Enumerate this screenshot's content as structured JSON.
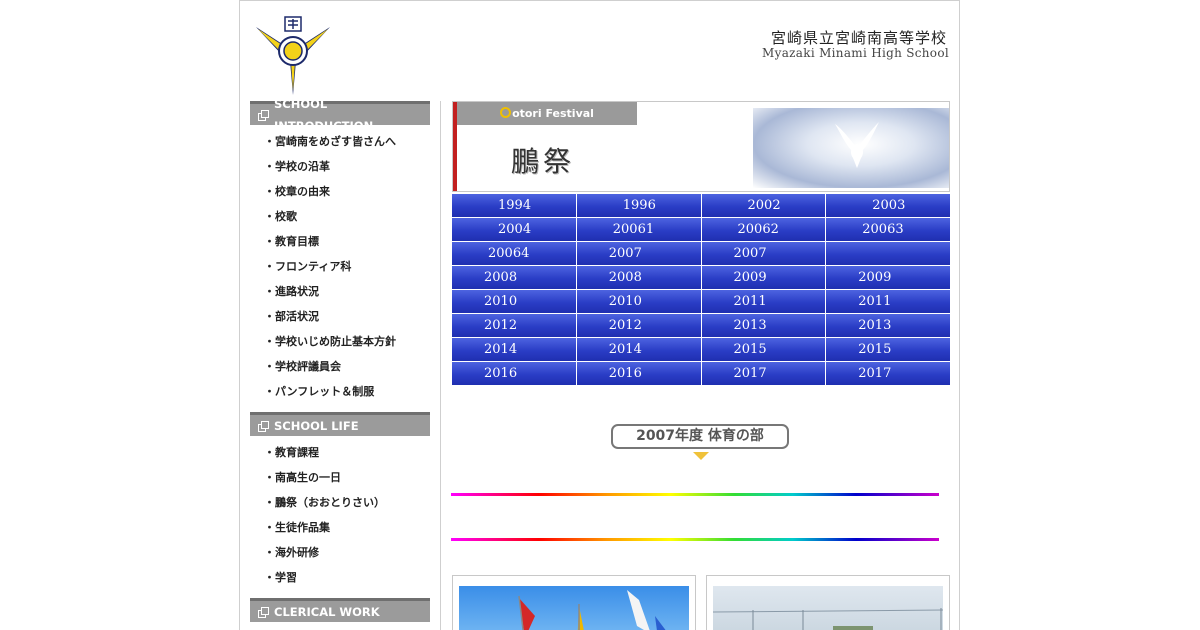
{
  "header": {
    "school_name_jp": "宮崎県立宮崎南高等学校",
    "school_name_en": "Myazaki Minami High School"
  },
  "sidebar": {
    "sections": [
      {
        "title": "SCHOOL INTRODUCTION",
        "items": [
          "宮崎南をめざす皆さんへ",
          "学校の沿革",
          "校章の由来",
          "校歌",
          "教育目標",
          "フロンティア科",
          "進路状況",
          "部活状況",
          "学校いじめ防止基本方針",
          "学校評議員会",
          "パンフレット＆制服"
        ]
      },
      {
        "title": "SCHOOL LIFE",
        "items": [
          "教育課程",
          "南高生の一日",
          "鵬祭（おおとりさい）",
          "生徒作品集",
          "海外研修",
          "学習"
        ]
      },
      {
        "title": "CLERICAL WORK",
        "items": []
      }
    ]
  },
  "banner": {
    "tab_label_first": "O",
    "tab_label_rest": "otori Festival",
    "title": "鵬祭"
  },
  "years": [
    [
      "1994",
      "1996",
      "2002",
      "2003"
    ],
    [
      "2004",
      "20061",
      "20062",
      "20063"
    ],
    [
      "20064",
      "2007",
      "2007",
      ""
    ],
    [
      "2008",
      "2008",
      "2009",
      "2009"
    ],
    [
      "2010",
      "2010",
      "2011",
      "2011"
    ],
    [
      "2012",
      "2012",
      "2013",
      "2013"
    ],
    [
      "2014",
      "2014",
      "2015",
      "2015"
    ],
    [
      "2016",
      "2016",
      "2017",
      "2017"
    ]
  ],
  "section_heading": "2007年度 体育の部",
  "colors": {
    "nav_button": "#2a3dc6",
    "section_head": "#9b9b9b",
    "banner_accent": "#c22020",
    "pill_arrow": "#f0c23a"
  }
}
